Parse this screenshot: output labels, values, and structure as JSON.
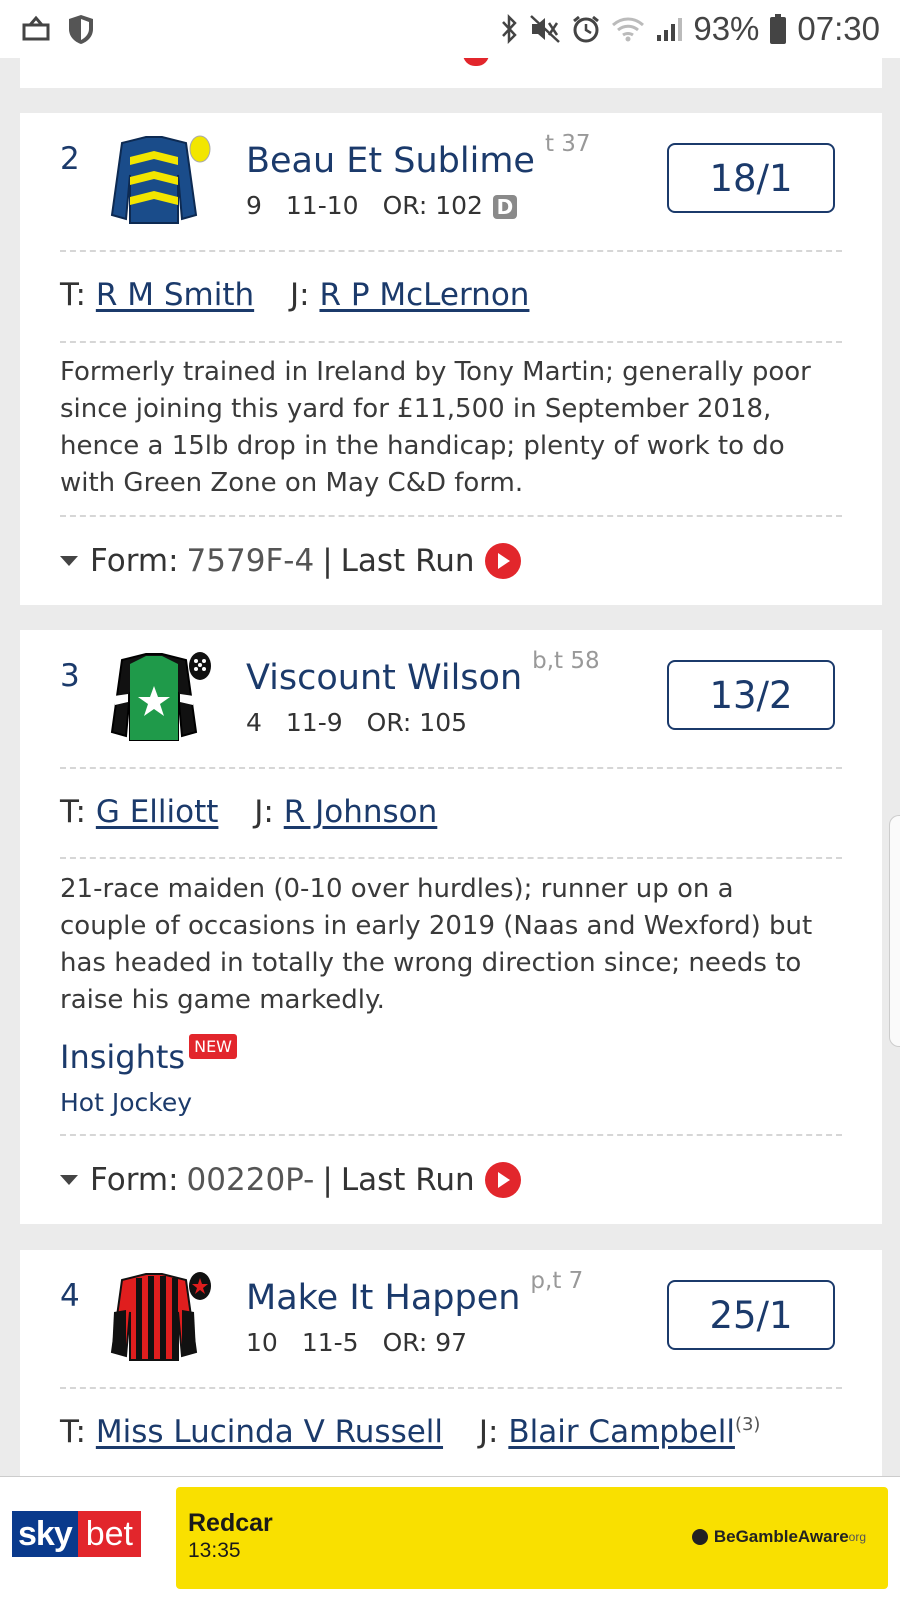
{
  "status_bar": {
    "battery": "93%",
    "time": "07:30",
    "icons": [
      "cast-icon",
      "shield-icon",
      "bluetooth-icon",
      "mute-icon",
      "alarm-icon",
      "wifi-icon",
      "signal-icon",
      "battery-icon"
    ]
  },
  "runners": [
    {
      "number": "2",
      "name": "Beau Et Sublime",
      "headgear_days": "t 37",
      "age": "9",
      "weight": "11-10",
      "or": "OR: 102",
      "badge": "D",
      "odds": "18/1",
      "trainer_prefix": "T:",
      "trainer": "R M Smith",
      "jockey_prefix": "J:",
      "jockey": "R P McLernon",
      "comment": "Formerly trained in Ireland by Tony Martin; generally poor since joining this yard for £11,500 in September 2018, hence a 15lb drop in the handicap; plenty of work to do with Green Zone on May C&D form.",
      "form_label": "Form:",
      "form": "7579F-4",
      "last_run": "Last Run"
    },
    {
      "number": "3",
      "name": "Viscount Wilson",
      "headgear_days": "b,t 58",
      "age": "4",
      "weight": "11-9",
      "or": "OR: 105",
      "odds": "13/2",
      "trainer_prefix": "T:",
      "trainer": "G Elliott",
      "jockey_prefix": "J:",
      "jockey": "R Johnson",
      "comment": "21-race maiden (0-10 over hurdles); runner up on a couple of occasions in early 2019 (Naas and Wexford) but has headed in totally the wrong direction since; needs to raise his game markedly.",
      "insights_title": "Insights",
      "new_badge": "NEW",
      "insight": "Hot Jockey",
      "form_label": "Form:",
      "form": "00220P-",
      "last_run": "Last Run"
    },
    {
      "number": "4",
      "name": "Make It Happen",
      "headgear_days": "p,t 7",
      "age": "10",
      "weight": "11-5",
      "or": "OR: 97",
      "odds": "25/1",
      "trainer_prefix": "T:",
      "trainer": "Miss Lucinda V Russell",
      "jockey_prefix": "J:",
      "jockey": "Blair Campbell",
      "jockey_claim": "(3)"
    }
  ],
  "banner": {
    "logo_sky": "sky",
    "logo_bet": "bet",
    "race_name": "Redcar",
    "race_time": "13:35",
    "gamble_aware": "BeGambleAware",
    "gamble_aware_suffix": "org"
  },
  "colors": {
    "navy": "#1b3a6b",
    "red": "#e2262c",
    "yellow": "#f9e000"
  }
}
